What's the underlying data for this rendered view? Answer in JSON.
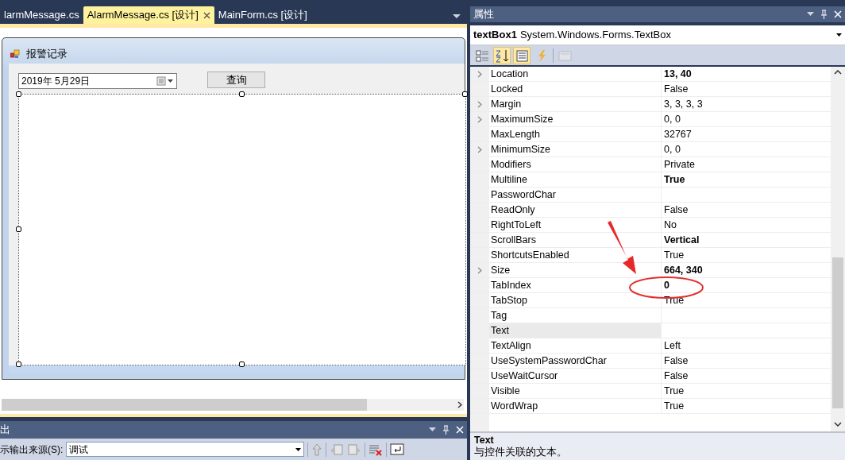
{
  "document_tabs": [
    {
      "label": "larmMessage.cs",
      "selected": false,
      "closable": false
    },
    {
      "label": "AlarmMessage.cs [设计]",
      "selected": true,
      "closable": true
    },
    {
      "label": "MainForm.cs [设计]",
      "selected": false,
      "closable": false
    }
  ],
  "designer": {
    "form_title": "报警记录",
    "date_picker": {
      "value": "2019年  5月29日"
    },
    "button": {
      "label": "查询"
    },
    "textbox": {
      "selected": true
    }
  },
  "output_panel": {
    "title": "出",
    "source_label": "示输出来源(S):",
    "source_value": "调试"
  },
  "properties_panel": {
    "title": "属性",
    "object": {
      "name": "textBox1",
      "type": "System.Windows.Forms.TextBox"
    },
    "toolbar": [
      {
        "kind": "categorized",
        "selected": false,
        "disabled": false
      },
      {
        "kind": "alphabetical",
        "selected": true,
        "disabled": false
      },
      {
        "kind": "properties",
        "selected": true,
        "disabled": false
      },
      {
        "kind": "events",
        "selected": false,
        "disabled": false
      },
      {
        "kind": "pages",
        "selected": false,
        "disabled": true
      }
    ],
    "rows": [
      {
        "name": "Location",
        "value": "13, 40",
        "bold": true,
        "expandable": true,
        "selected": false
      },
      {
        "name": "Locked",
        "value": "False",
        "bold": false,
        "expandable": false,
        "selected": false
      },
      {
        "name": "Margin",
        "value": "3, 3, 3, 3",
        "bold": false,
        "expandable": true,
        "selected": false
      },
      {
        "name": "MaximumSize",
        "value": "0, 0",
        "bold": false,
        "expandable": true,
        "selected": false
      },
      {
        "name": "MaxLength",
        "value": "32767",
        "bold": false,
        "expandable": false,
        "selected": false
      },
      {
        "name": "MinimumSize",
        "value": "0, 0",
        "bold": false,
        "expandable": true,
        "selected": false
      },
      {
        "name": "Modifiers",
        "value": "Private",
        "bold": false,
        "expandable": false,
        "selected": false
      },
      {
        "name": "Multiline",
        "value": "True",
        "bold": true,
        "expandable": false,
        "selected": false
      },
      {
        "name": "PasswordChar",
        "expandable": false,
        "selected": false
      },
      {
        "name": "ReadOnly",
        "value": "False",
        "bold": false,
        "expandable": false,
        "selected": false
      },
      {
        "name": "RightToLeft",
        "value": "No",
        "bold": false,
        "expandable": false,
        "selected": false
      },
      {
        "name": "ScrollBars",
        "value": "Vertical",
        "bold": true,
        "expandable": false,
        "selected": false
      },
      {
        "name": "ShortcutsEnabled",
        "value": "True",
        "bold": false,
        "expandable": false,
        "selected": false
      },
      {
        "name": "Size",
        "value": "664, 340",
        "bold": true,
        "expandable": true,
        "selected": false
      },
      {
        "name": "TabIndex",
        "value": "0",
        "bold": true,
        "expandable": false,
        "selected": false
      },
      {
        "name": "TabStop",
        "value": "True",
        "bold": false,
        "expandable": false,
        "selected": false
      },
      {
        "name": "Tag",
        "expandable": false,
        "selected": false
      },
      {
        "name": "Text",
        "expandable": false,
        "selected": true
      },
      {
        "name": "TextAlign",
        "value": "Left",
        "bold": false,
        "expandable": false,
        "selected": false
      },
      {
        "name": "UseSystemPasswordChar",
        "value": "False",
        "bold": false,
        "expandable": false,
        "selected": false
      },
      {
        "name": "UseWaitCursor",
        "value": "False",
        "bold": false,
        "expandable": false,
        "selected": false
      },
      {
        "name": "Visible",
        "value": "True",
        "bold": false,
        "expandable": false,
        "selected": false
      },
      {
        "name": "WordWrap",
        "value": "True",
        "bold": false,
        "expandable": false,
        "selected": false
      }
    ],
    "description": {
      "title": "Text",
      "text": "与控件关联的文本。"
    }
  },
  "annotations": [
    {
      "kind": "arrow"
    },
    {
      "kind": "ellipse"
    }
  ]
}
